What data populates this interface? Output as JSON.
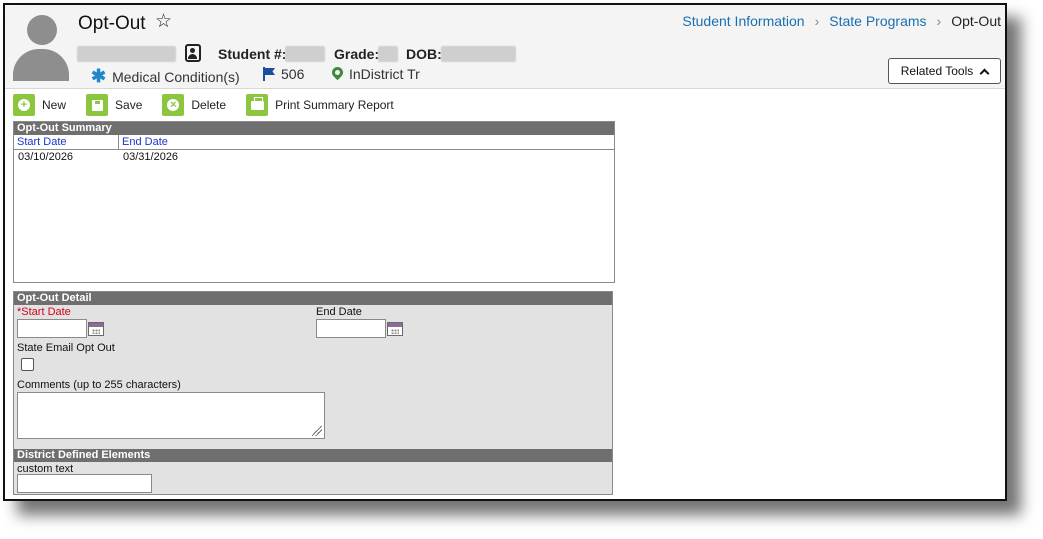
{
  "header": {
    "page_title": "Opt-Out",
    "student_label": "Student #:",
    "grade_label": "Grade:",
    "dob_label": "DOB:",
    "flags": [
      {
        "icon": "asterisk-icon",
        "label": "Medical Condition(s)",
        "color": "#1e88c8"
      },
      {
        "icon": "flag-icon",
        "label": "506",
        "color": "#1a4fa0"
      },
      {
        "icon": "map-pin-icon",
        "label": "InDistrict Tr",
        "color": "#3f8a3f"
      }
    ],
    "breadcrumb": [
      "Student Information",
      "State Programs",
      "Opt-Out"
    ],
    "related_tools_label": "Related Tools"
  },
  "toolbar": {
    "new_label": "New",
    "save_label": "Save",
    "delete_label": "Delete",
    "print_label": "Print Summary Report",
    "accent_color": "#8cc63f"
  },
  "summary": {
    "title": "Opt-Out Summary",
    "columns": [
      "Start Date",
      "End Date"
    ],
    "rows": [
      {
        "start": "03/10/2026",
        "end": "03/31/2026"
      }
    ]
  },
  "detail": {
    "title": "Opt-Out Detail",
    "start_date_label": "*Start Date",
    "start_date_value": "",
    "end_date_label": "End Date",
    "end_date_value": "",
    "email_opt_out_label": "State Email Opt Out",
    "email_opt_out_checked": false,
    "comments_label": "Comments (up to 255 characters)",
    "comments_value": "",
    "district_title": "District Defined Elements",
    "custom_text_label": "custom text",
    "custom_text_value": ""
  }
}
